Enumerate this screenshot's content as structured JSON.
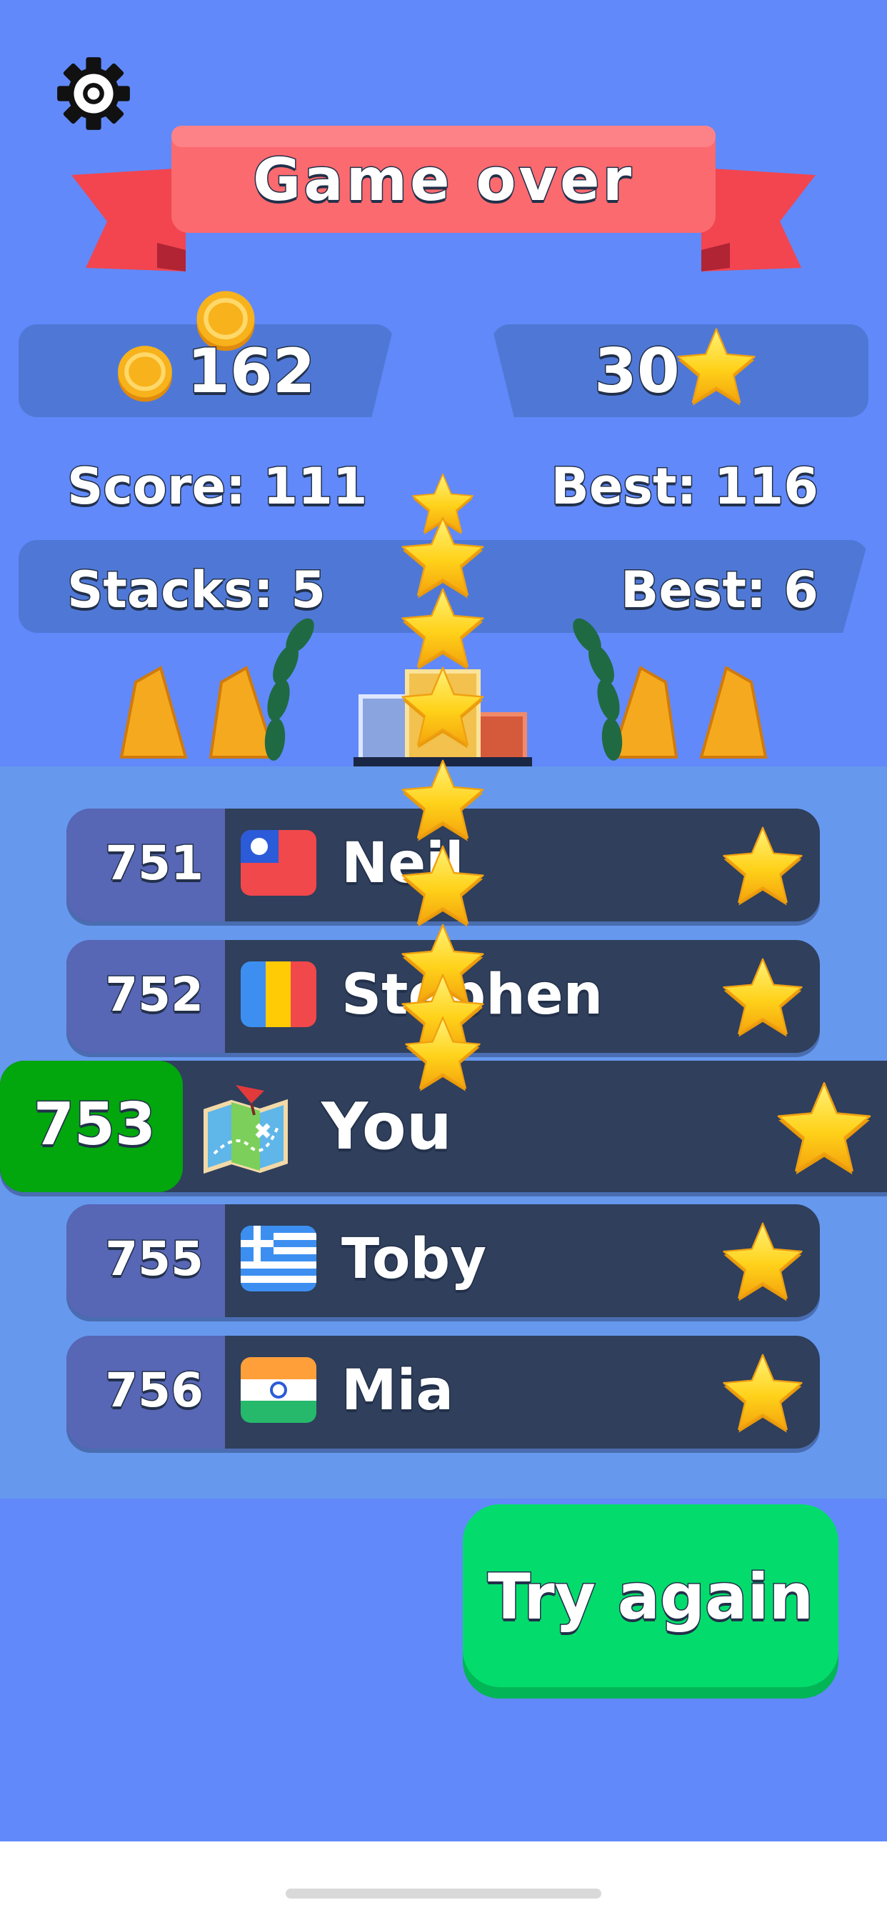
{
  "header": {
    "title": "Game over"
  },
  "currency": {
    "coins": "162",
    "stars": "30"
  },
  "stats": {
    "score_label": "Score: 111",
    "best_score_label": "Best: 116",
    "stacks_label": "Stacks: 5",
    "best_stacks_label": "Best: 6"
  },
  "leaderboard": [
    {
      "rank": "751",
      "name": "Neil",
      "flag": "taiwan"
    },
    {
      "rank": "752",
      "name": "Stephen",
      "flag": "romania"
    },
    {
      "rank": "753",
      "name": "You",
      "flag": "map-icon",
      "highlighted": true
    },
    {
      "rank": "755",
      "name": "Toby",
      "flag": "greece"
    },
    {
      "rank": "756",
      "name": "Mia",
      "flag": "india"
    }
  ],
  "actions": {
    "try_again": "Try again"
  },
  "icons": {
    "settings": "gear-icon",
    "coin": "coin-icon",
    "star": "star-icon"
  },
  "colors": {
    "background": "#6189fa",
    "banner": "#fb6a6f",
    "row": "#2f3f5c",
    "rank_box": "#5766b5",
    "you_rank": "#02a60d",
    "button": "#03dc6c",
    "star": "#ffd21a",
    "coin": "#f7b21c"
  }
}
